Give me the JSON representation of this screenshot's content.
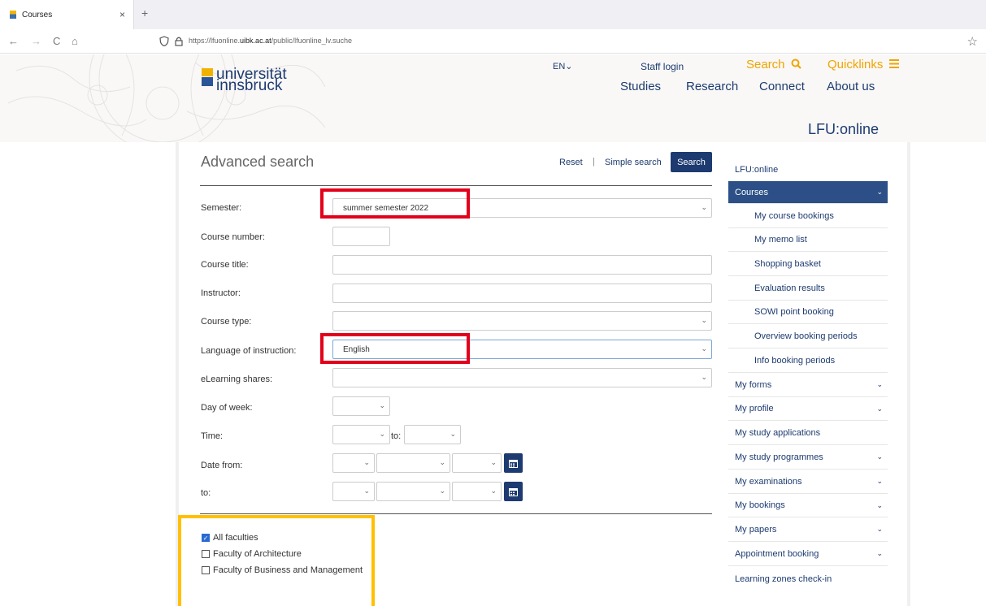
{
  "browser": {
    "tab_title": "Courses",
    "tab_close": "×",
    "new_tab": "+",
    "back": "←",
    "forward": "→",
    "reload": "C",
    "home": "⌂",
    "url_prefix": "https://lfuonline.",
    "url_domain": "uibk.ac.at",
    "url_path": "/public/lfuonline_lv.suche",
    "bookmark": "☆"
  },
  "header": {
    "logo_line1": "universität",
    "logo_line2": "innsbruck",
    "lang": "EN⌄",
    "staff_login": "Staff login",
    "search": "Search",
    "quicklinks": "Quicklinks",
    "nav": [
      "Studies",
      "Research",
      "Connect",
      "About us"
    ],
    "subtitle": "LFU:online"
  },
  "form": {
    "title": "Advanced search",
    "reset": "Reset",
    "separator": "|",
    "simple_search": "Simple search",
    "search_button": "Search",
    "fields": {
      "semester_label": "Semester:",
      "semester_value": "summer semester 2022",
      "course_number_label": "Course number:",
      "course_title_label": "Course title:",
      "instructor_label": "Instructor:",
      "course_type_label": "Course type:",
      "language_label": "Language of instruction:",
      "language_value": "English",
      "elearning_label": "eLearning shares:",
      "day_label": "Day of week:",
      "time_label": "Time:",
      "time_to": "to:",
      "date_from_label": "Date from:",
      "to_label": "to:"
    },
    "faculties": [
      {
        "label": "All faculties",
        "checked": true
      },
      {
        "label": "Faculty of Architecture",
        "checked": false
      },
      {
        "label": "Faculty of Business and Management",
        "checked": false
      }
    ]
  },
  "sidebar": {
    "items": [
      {
        "label": "LFU:online",
        "type": "main"
      },
      {
        "label": "Courses",
        "type": "main",
        "active": true
      },
      {
        "label": "My course bookings",
        "type": "sub"
      },
      {
        "label": "My memo list",
        "type": "sub"
      },
      {
        "label": "Shopping basket",
        "type": "sub"
      },
      {
        "label": "Evaluation results",
        "type": "sub"
      },
      {
        "label": "SOWI point booking",
        "type": "sub"
      },
      {
        "label": "Overview booking periods",
        "type": "sub"
      },
      {
        "label": "Info booking periods",
        "type": "sub"
      },
      {
        "label": "My forms",
        "type": "main"
      },
      {
        "label": "My profile",
        "type": "main"
      },
      {
        "label": "My study applications",
        "type": "main"
      },
      {
        "label": "My study programmes",
        "type": "main"
      },
      {
        "label": "My examinations",
        "type": "main"
      },
      {
        "label": "My bookings",
        "type": "main"
      },
      {
        "label": "My papers",
        "type": "main"
      },
      {
        "label": "Appointment booking",
        "type": "main"
      },
      {
        "label": "Learning zones check-in",
        "type": "main"
      }
    ]
  },
  "colors": {
    "brand_blue": "#1d3b70",
    "accent_orange": "#f0a400",
    "highlight_red": "#e3001b",
    "highlight_yellow": "#ffc000"
  }
}
